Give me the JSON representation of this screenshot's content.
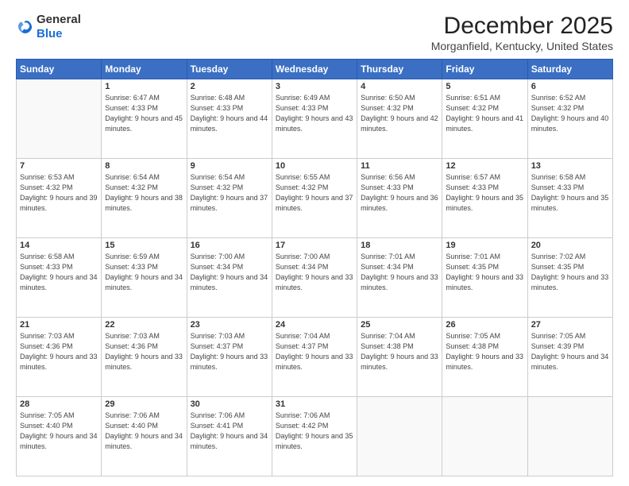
{
  "header": {
    "logo_general": "General",
    "logo_blue": "Blue",
    "month_title": "December 2025",
    "location": "Morganfield, Kentucky, United States"
  },
  "weekdays": [
    "Sunday",
    "Monday",
    "Tuesday",
    "Wednesday",
    "Thursday",
    "Friday",
    "Saturday"
  ],
  "weeks": [
    [
      {
        "day": "",
        "sunrise": "",
        "sunset": "",
        "daylight": ""
      },
      {
        "day": "1",
        "sunrise": "Sunrise: 6:47 AM",
        "sunset": "Sunset: 4:33 PM",
        "daylight": "Daylight: 9 hours and 45 minutes."
      },
      {
        "day": "2",
        "sunrise": "Sunrise: 6:48 AM",
        "sunset": "Sunset: 4:33 PM",
        "daylight": "Daylight: 9 hours and 44 minutes."
      },
      {
        "day": "3",
        "sunrise": "Sunrise: 6:49 AM",
        "sunset": "Sunset: 4:33 PM",
        "daylight": "Daylight: 9 hours and 43 minutes."
      },
      {
        "day": "4",
        "sunrise": "Sunrise: 6:50 AM",
        "sunset": "Sunset: 4:32 PM",
        "daylight": "Daylight: 9 hours and 42 minutes."
      },
      {
        "day": "5",
        "sunrise": "Sunrise: 6:51 AM",
        "sunset": "Sunset: 4:32 PM",
        "daylight": "Daylight: 9 hours and 41 minutes."
      },
      {
        "day": "6",
        "sunrise": "Sunrise: 6:52 AM",
        "sunset": "Sunset: 4:32 PM",
        "daylight": "Daylight: 9 hours and 40 minutes."
      }
    ],
    [
      {
        "day": "7",
        "sunrise": "Sunrise: 6:53 AM",
        "sunset": "Sunset: 4:32 PM",
        "daylight": "Daylight: 9 hours and 39 minutes."
      },
      {
        "day": "8",
        "sunrise": "Sunrise: 6:54 AM",
        "sunset": "Sunset: 4:32 PM",
        "daylight": "Daylight: 9 hours and 38 minutes."
      },
      {
        "day": "9",
        "sunrise": "Sunrise: 6:54 AM",
        "sunset": "Sunset: 4:32 PM",
        "daylight": "Daylight: 9 hours and 37 minutes."
      },
      {
        "day": "10",
        "sunrise": "Sunrise: 6:55 AM",
        "sunset": "Sunset: 4:32 PM",
        "daylight": "Daylight: 9 hours and 37 minutes."
      },
      {
        "day": "11",
        "sunrise": "Sunrise: 6:56 AM",
        "sunset": "Sunset: 4:33 PM",
        "daylight": "Daylight: 9 hours and 36 minutes."
      },
      {
        "day": "12",
        "sunrise": "Sunrise: 6:57 AM",
        "sunset": "Sunset: 4:33 PM",
        "daylight": "Daylight: 9 hours and 35 minutes."
      },
      {
        "day": "13",
        "sunrise": "Sunrise: 6:58 AM",
        "sunset": "Sunset: 4:33 PM",
        "daylight": "Daylight: 9 hours and 35 minutes."
      }
    ],
    [
      {
        "day": "14",
        "sunrise": "Sunrise: 6:58 AM",
        "sunset": "Sunset: 4:33 PM",
        "daylight": "Daylight: 9 hours and 34 minutes."
      },
      {
        "day": "15",
        "sunrise": "Sunrise: 6:59 AM",
        "sunset": "Sunset: 4:33 PM",
        "daylight": "Daylight: 9 hours and 34 minutes."
      },
      {
        "day": "16",
        "sunrise": "Sunrise: 7:00 AM",
        "sunset": "Sunset: 4:34 PM",
        "daylight": "Daylight: 9 hours and 34 minutes."
      },
      {
        "day": "17",
        "sunrise": "Sunrise: 7:00 AM",
        "sunset": "Sunset: 4:34 PM",
        "daylight": "Daylight: 9 hours and 33 minutes."
      },
      {
        "day": "18",
        "sunrise": "Sunrise: 7:01 AM",
        "sunset": "Sunset: 4:34 PM",
        "daylight": "Daylight: 9 hours and 33 minutes."
      },
      {
        "day": "19",
        "sunrise": "Sunrise: 7:01 AM",
        "sunset": "Sunset: 4:35 PM",
        "daylight": "Daylight: 9 hours and 33 minutes."
      },
      {
        "day": "20",
        "sunrise": "Sunrise: 7:02 AM",
        "sunset": "Sunset: 4:35 PM",
        "daylight": "Daylight: 9 hours and 33 minutes."
      }
    ],
    [
      {
        "day": "21",
        "sunrise": "Sunrise: 7:03 AM",
        "sunset": "Sunset: 4:36 PM",
        "daylight": "Daylight: 9 hours and 33 minutes."
      },
      {
        "day": "22",
        "sunrise": "Sunrise: 7:03 AM",
        "sunset": "Sunset: 4:36 PM",
        "daylight": "Daylight: 9 hours and 33 minutes."
      },
      {
        "day": "23",
        "sunrise": "Sunrise: 7:03 AM",
        "sunset": "Sunset: 4:37 PM",
        "daylight": "Daylight: 9 hours and 33 minutes."
      },
      {
        "day": "24",
        "sunrise": "Sunrise: 7:04 AM",
        "sunset": "Sunset: 4:37 PM",
        "daylight": "Daylight: 9 hours and 33 minutes."
      },
      {
        "day": "25",
        "sunrise": "Sunrise: 7:04 AM",
        "sunset": "Sunset: 4:38 PM",
        "daylight": "Daylight: 9 hours and 33 minutes."
      },
      {
        "day": "26",
        "sunrise": "Sunrise: 7:05 AM",
        "sunset": "Sunset: 4:38 PM",
        "daylight": "Daylight: 9 hours and 33 minutes."
      },
      {
        "day": "27",
        "sunrise": "Sunrise: 7:05 AM",
        "sunset": "Sunset: 4:39 PM",
        "daylight": "Daylight: 9 hours and 34 minutes."
      }
    ],
    [
      {
        "day": "28",
        "sunrise": "Sunrise: 7:05 AM",
        "sunset": "Sunset: 4:40 PM",
        "daylight": "Daylight: 9 hours and 34 minutes."
      },
      {
        "day": "29",
        "sunrise": "Sunrise: 7:06 AM",
        "sunset": "Sunset: 4:40 PM",
        "daylight": "Daylight: 9 hours and 34 minutes."
      },
      {
        "day": "30",
        "sunrise": "Sunrise: 7:06 AM",
        "sunset": "Sunset: 4:41 PM",
        "daylight": "Daylight: 9 hours and 34 minutes."
      },
      {
        "day": "31",
        "sunrise": "Sunrise: 7:06 AM",
        "sunset": "Sunset: 4:42 PM",
        "daylight": "Daylight: 9 hours and 35 minutes."
      },
      {
        "day": "",
        "sunrise": "",
        "sunset": "",
        "daylight": ""
      },
      {
        "day": "",
        "sunrise": "",
        "sunset": "",
        "daylight": ""
      },
      {
        "day": "",
        "sunrise": "",
        "sunset": "",
        "daylight": ""
      }
    ]
  ]
}
